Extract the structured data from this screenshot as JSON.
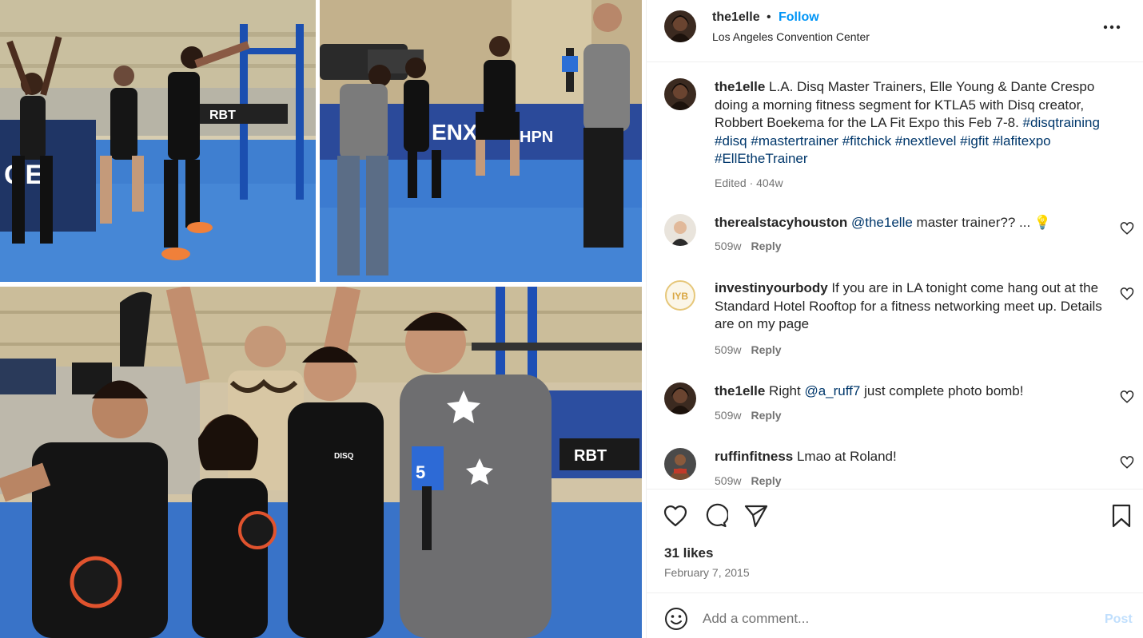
{
  "post": {
    "username": "the1elle",
    "dot": "•",
    "follow_label": "Follow",
    "location": "Los Angeles Convention Center",
    "more_icon": "more-horizontal-icon"
  },
  "caption": {
    "username": "the1elle",
    "text": "L.A. Disq Master Trainers, Elle Young & Dante Crespo doing a morning fitness segment for KTLA5 with Disq creator, Robbert Boekema for the LA Fit Expo this Feb 7-8.",
    "hashtags": [
      "#disqtraining",
      "#disq",
      "#mastertrainer",
      "#fitchick",
      "#nextlevel",
      "#igfit",
      "#lafitexpo",
      "#EllEtheTrainer"
    ],
    "meta": "Edited · 404w"
  },
  "comments": [
    {
      "username": "therealstacyhouston",
      "mention": "@the1elle",
      "text": "master trainer?? ... 💡",
      "age": "509w",
      "reply": "Reply"
    },
    {
      "username": "investinyourbody",
      "mention": "",
      "text": "If you are in LA tonight come hang out at the Standard Hotel Rooftop for a fitness networking meet up. Details are on my page",
      "age": "509w",
      "reply": "Reply"
    },
    {
      "username": "the1elle",
      "mention": "@a_ruff7",
      "text_before": "Right",
      "text": "just complete photo bomb!",
      "age": "509w",
      "reply": "Reply"
    },
    {
      "username": "ruffinfitness",
      "mention": "",
      "text": "Lmao at Roland!",
      "age": "509w",
      "reply": "Reply"
    }
  ],
  "actions": {
    "likes": "31 likes",
    "date": "February 7, 2015",
    "icons": [
      "heart-icon",
      "comment-icon",
      "share-icon",
      "bookmark-icon"
    ]
  },
  "add_comment": {
    "placeholder": "Add a comment...",
    "post_label": "Post"
  },
  "colors": {
    "accent": "#0095f6",
    "link": "#00376b",
    "muted": "#737373",
    "text": "#262626",
    "post_disabled": "#c0dffd"
  }
}
